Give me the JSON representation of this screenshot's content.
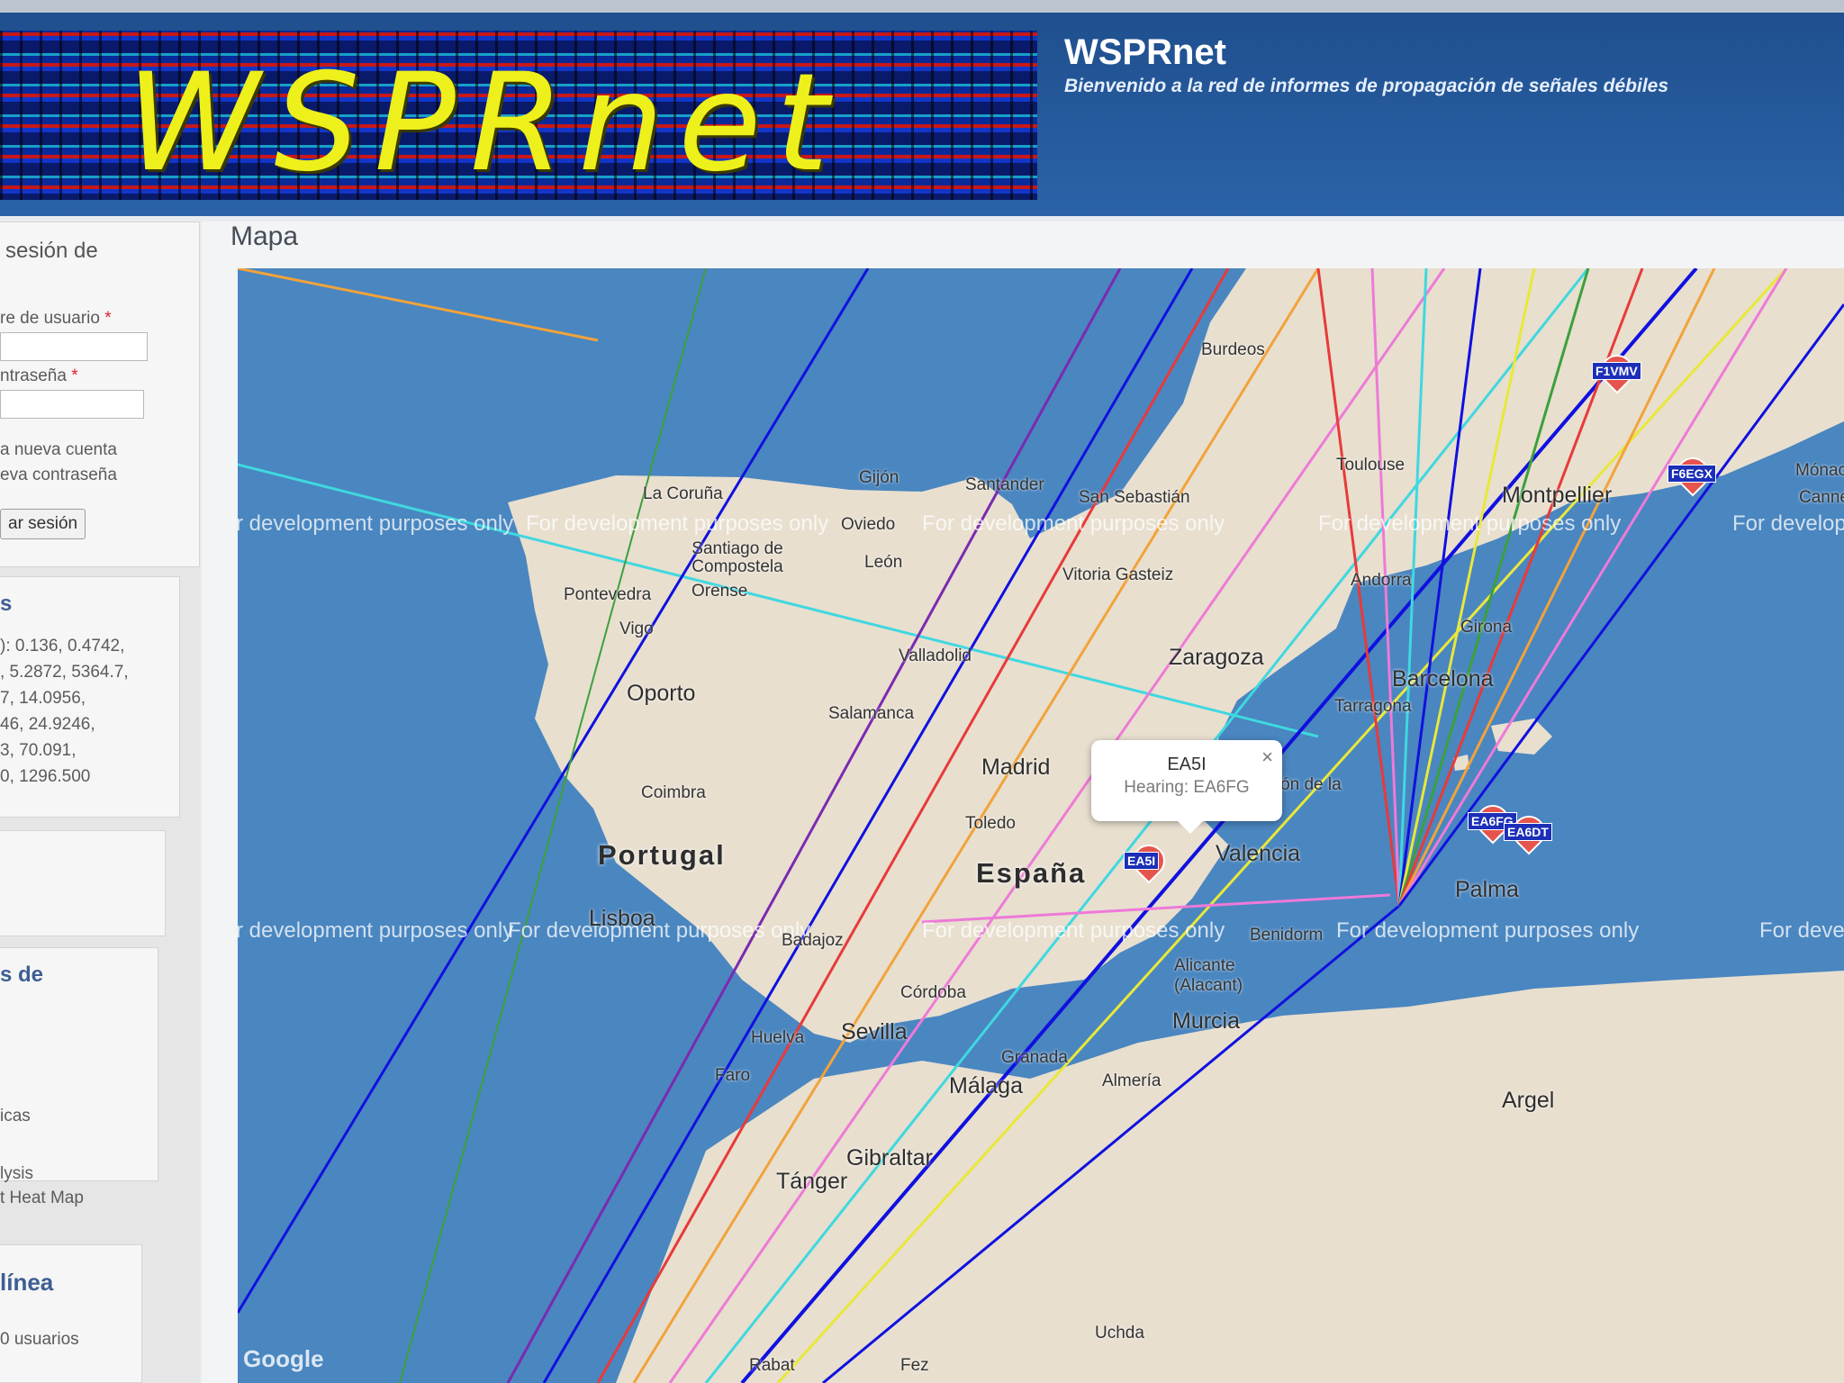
{
  "header": {
    "logo_text": "WSPRnet",
    "title": "WSPRnet",
    "subtitle": "Bienvenido a la red de informes de propagación de señales débiles"
  },
  "sidebar": {
    "login": {
      "heading": "sesión de",
      "username_label": "re de usuario",
      "password_label": "ntraseña",
      "required_mark": "*",
      "new_account_link": "a nueva cuenta",
      "new_password_link": "eva contraseña",
      "login_button": "ar sesión"
    },
    "bands": {
      "heading": "s",
      "lines": [
        "): 0.136, 0.4742,",
        ", 5.2872, 5364.7,",
        "7, 14.0956,",
        "46, 24.9246,",
        "3, 70.091,",
        "0, 1296.500"
      ]
    },
    "links": {
      "heading": "s de",
      "items": [
        "icas",
        "lysis",
        "t Heat Map"
      ]
    },
    "online": {
      "heading": "línea",
      "text": "0 usuarios"
    }
  },
  "main": {
    "title": "Mapa"
  },
  "map": {
    "watermark_text": "For development purposes only",
    "google_logo": "Google",
    "countries": [
      "Portugal",
      "España"
    ],
    "cities": [
      "La Coruña",
      "Gijón",
      "Oviedo",
      "Santander",
      "San Sebastián",
      "Santiago de Compostela",
      "León",
      "Pontevedra",
      "Orense",
      "Vigo",
      "Vitoria Gasteiz",
      "Valladolid",
      "Oporto",
      "Salamanca",
      "Zaragoza",
      "Barcelona",
      "Tarragona",
      "Coimbra",
      "Madrid",
      "Toledo",
      "Castellón de la Plana",
      "Valencia",
      "Lisboa",
      "Badajoz",
      "Benidorm",
      "Alicante (Alacant)",
      "Córdoba",
      "Murcia",
      "Huelva",
      "Sevilla",
      "Faro",
      "Granada",
      "Almería",
      "Málaga",
      "Gibraltar",
      "Tánger",
      "Argel",
      "Palma",
      "Uchda",
      "Fez",
      "Rabat",
      "Burdeos",
      "Toulouse",
      "Montpellier",
      "Andorra",
      "Girona",
      "Mónaco",
      "Cannes"
    ],
    "markers": [
      "EA5I",
      "F1VMV",
      "F6EGX",
      "EA6FG",
      "EA6DT"
    ],
    "popup": {
      "title": "EA5I",
      "body": "Hearing: EA6FG",
      "close_icon": "×"
    }
  }
}
